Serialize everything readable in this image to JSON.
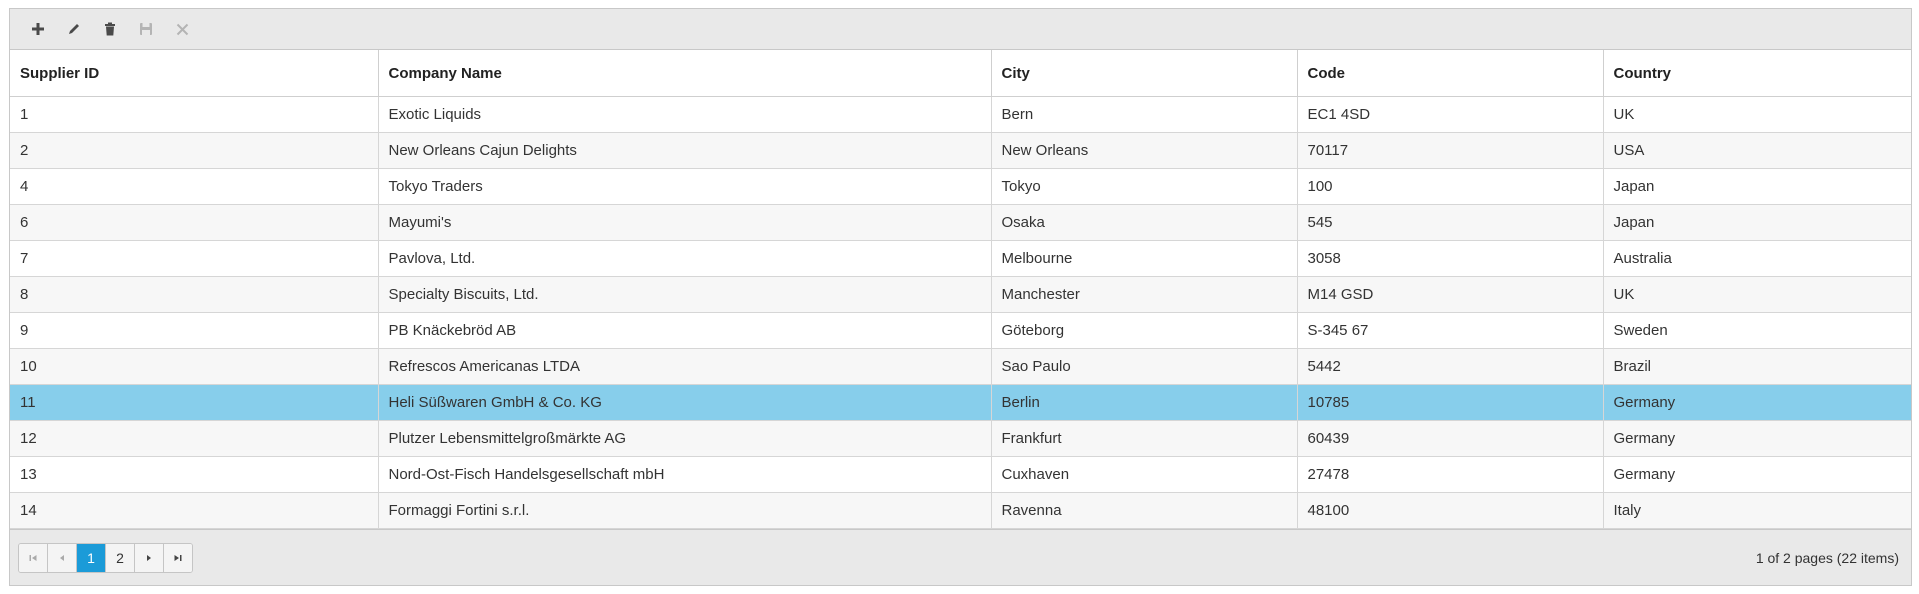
{
  "toolbar": {
    "buttons": [
      {
        "name": "add-button",
        "icon": "plus-icon"
      },
      {
        "name": "edit-button",
        "icon": "pencil-icon"
      },
      {
        "name": "delete-button",
        "icon": "trash-icon"
      },
      {
        "name": "save-button",
        "icon": "save-icon"
      },
      {
        "name": "cancel-button",
        "icon": "close-icon"
      }
    ]
  },
  "columns": [
    "Supplier ID",
    "Company Name",
    "City",
    "Code",
    "Country"
  ],
  "rows": [
    [
      "1",
      "Exotic Liquids",
      "Bern",
      "EC1 4SD",
      "UK"
    ],
    [
      "2",
      "New Orleans Cajun Delights",
      "New Orleans",
      "70117",
      "USA"
    ],
    [
      "4",
      "Tokyo Traders",
      "Tokyo",
      "100",
      "Japan"
    ],
    [
      "6",
      "Mayumi's",
      "Osaka",
      "545",
      "Japan"
    ],
    [
      "7",
      "Pavlova, Ltd.",
      "Melbourne",
      "3058",
      "Australia"
    ],
    [
      "8",
      "Specialty Biscuits, Ltd.",
      "Manchester",
      "M14 GSD",
      "UK"
    ],
    [
      "9",
      "PB Knäckebröd AB",
      "Göteborg",
      "S-345 67",
      "Sweden"
    ],
    [
      "10",
      "Refrescos Americanas LTDA",
      "Sao Paulo",
      "5442",
      "Brazil"
    ],
    [
      "11",
      "Heli Süßwaren GmbH & Co. KG",
      "Berlin",
      "10785",
      "Germany"
    ],
    [
      "12",
      "Plutzer Lebensmittelgroßmärkte AG",
      "Frankfurt",
      "60439",
      "Germany"
    ],
    [
      "13",
      "Nord-Ost-Fisch Handelsgesellschaft mbH",
      "Cuxhaven",
      "27478",
      "Germany"
    ],
    [
      "14",
      "Formaggi Fortini s.r.l.",
      "Ravenna",
      "48100",
      "Italy"
    ]
  ],
  "selected_row_index": 8,
  "colors": {
    "selected_row": "#87ceeb",
    "active_page": "#1b9bd8"
  },
  "pager": {
    "pages": [
      "1",
      "2"
    ],
    "current_page": "1",
    "info": "1 of 2 pages (22 items)"
  }
}
